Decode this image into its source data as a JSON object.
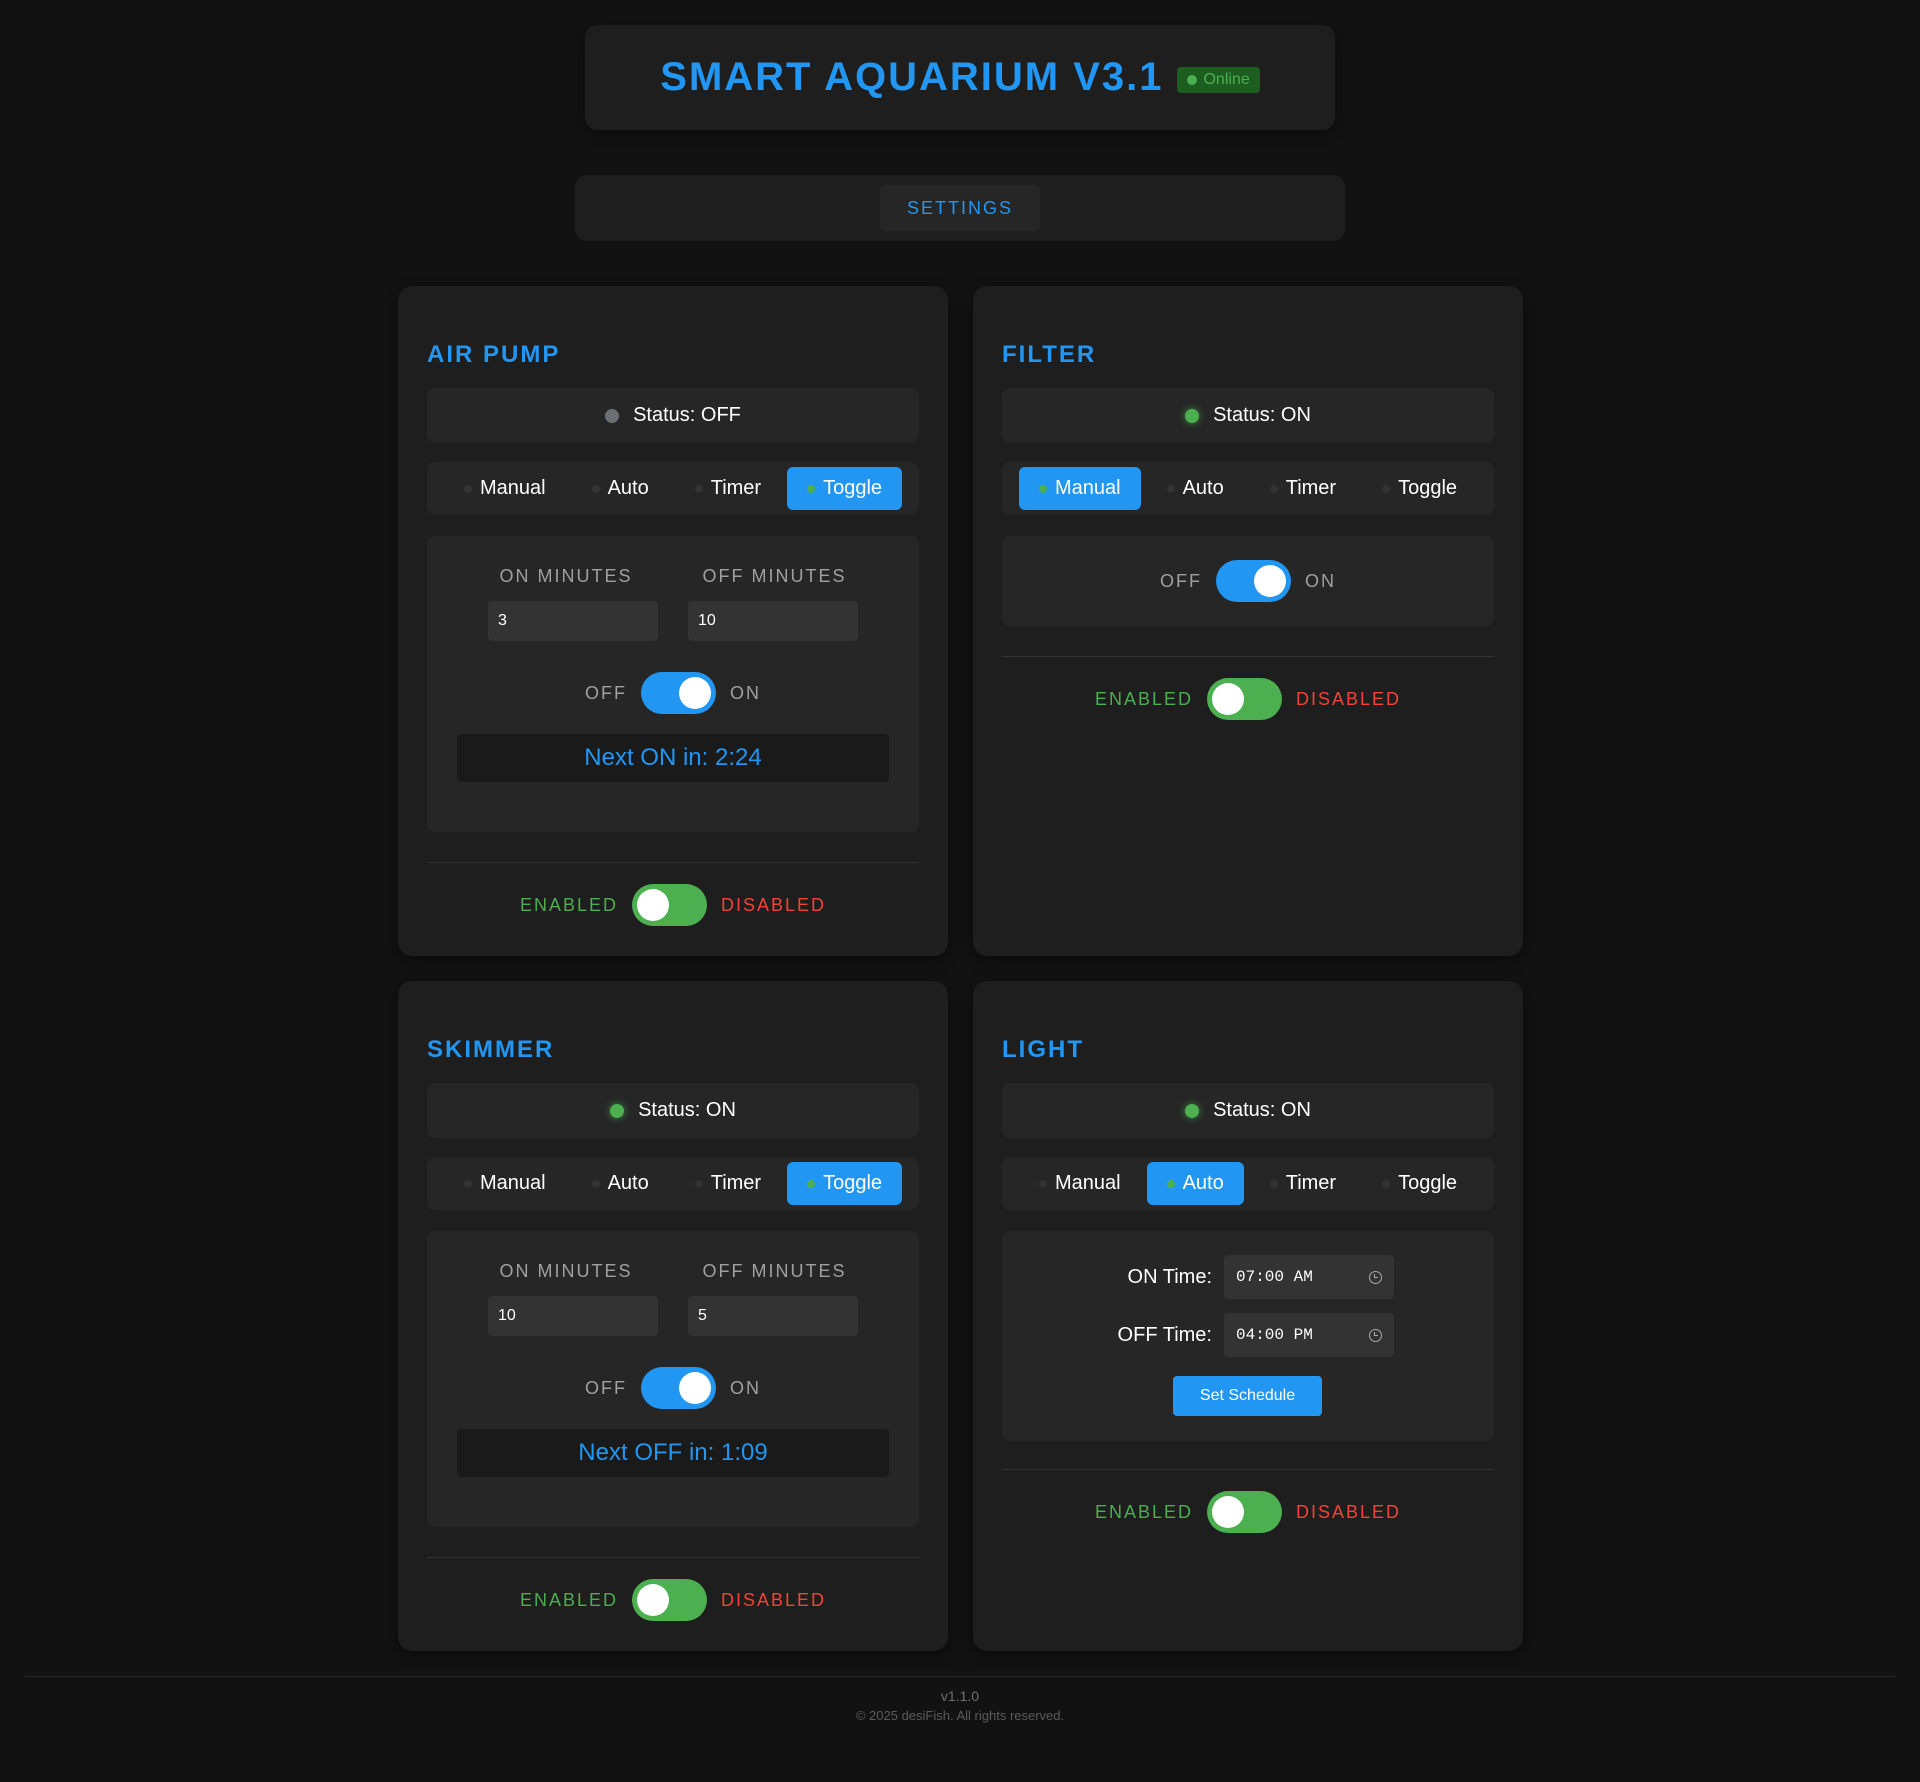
{
  "header": {
    "title": "SMART AQUARIUM V3.1",
    "status_badge": "Online"
  },
  "nav": {
    "settings_label": "SETTINGS"
  },
  "modes": [
    "Manual",
    "Auto",
    "Timer",
    "Toggle"
  ],
  "labels": {
    "on_minutes": "ON MINUTES",
    "off_minutes": "OFF MINUTES",
    "off": "OFF",
    "on": "ON",
    "enabled": "ENABLED",
    "disabled": "DISABLED",
    "on_time": "ON Time:",
    "off_time": "OFF Time:",
    "set_schedule": "Set Schedule"
  },
  "devices": {
    "air_pump": {
      "title": "AIR PUMP",
      "status": "Status: OFF",
      "active_mode": "Toggle",
      "on_minutes": "3",
      "off_minutes": "10",
      "countdown": "Next ON in: 2:24"
    },
    "filter": {
      "title": "FILTER",
      "status": "Status: ON",
      "active_mode": "Manual"
    },
    "skimmer": {
      "title": "SKIMMER",
      "status": "Status: ON",
      "active_mode": "Toggle",
      "on_minutes": "10",
      "off_minutes": "5",
      "countdown": "Next OFF in: 1:09"
    },
    "light": {
      "title": "LIGHT",
      "status": "Status: ON",
      "active_mode": "Auto",
      "on_time": "07:00 AM",
      "off_time": "04:00 PM"
    }
  },
  "footer": {
    "version": "v1.1.0",
    "copyright": "© 2025 desiFish. All rights reserved."
  },
  "colors": {
    "accent": "#2196f3",
    "success": "#4caf50",
    "danger": "#f44336",
    "background": "#121212",
    "card": "#1e1e1e"
  }
}
